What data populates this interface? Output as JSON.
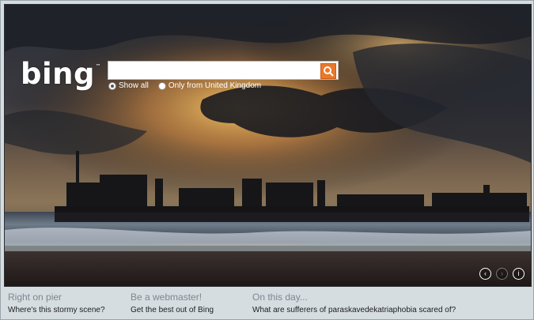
{
  "brand": {
    "name": "bing",
    "tm": "™"
  },
  "search": {
    "value": "",
    "placeholder": ""
  },
  "scope": {
    "options": [
      {
        "label": "Show all",
        "checked": true
      },
      {
        "label": "Only from United Kingdom",
        "checked": false
      }
    ]
  },
  "hero_nav": {
    "prev": "‹",
    "next": "›",
    "info": "i"
  },
  "footer": {
    "columns": [
      {
        "heading": "Right on pier",
        "link": "Where's this stormy scene?"
      },
      {
        "heading": "Be a webmaster!",
        "link": "Get the best out of Bing"
      },
      {
        "heading": "On this day...",
        "link": "What are sufferers of paraskavedekatriaphobia scared of?"
      }
    ]
  },
  "colors": {
    "accent": "#e9782b",
    "footer_heading": "#7a8791"
  }
}
